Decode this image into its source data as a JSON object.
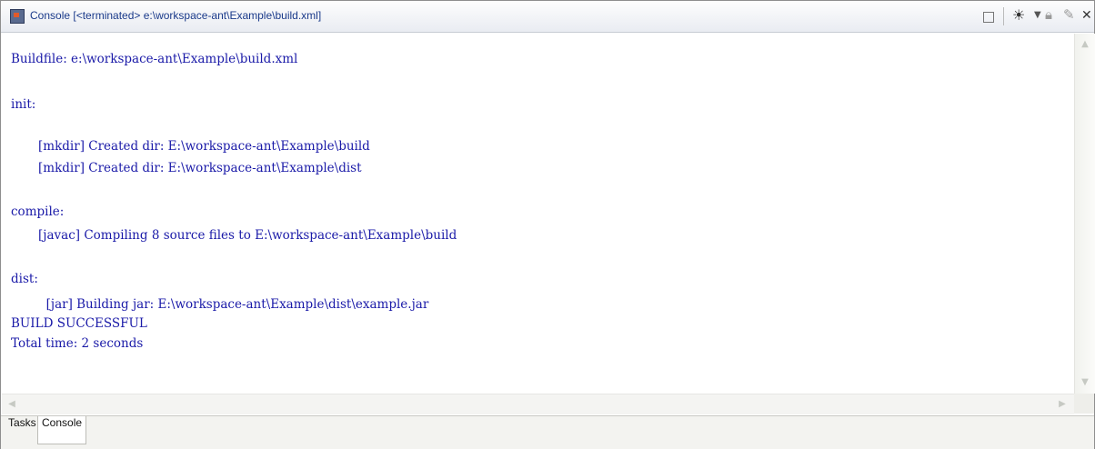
{
  "window": {
    "title": "Console [<terminated> e:\\workspace-ant\\Example\\build.xml]"
  },
  "console": {
    "lines": [
      "Buildfile: e:\\workspace-ant\\Example\\build.xml",
      "",
      "init:",
      "       [mkdir] Created dir: E:\\workspace-ant\\Example\\build",
      "       [mkdir] Created dir: E:\\workspace-ant\\Example\\dist",
      "",
      "compile:",
      "       [javac] Compiling 8 source files to E:\\workspace-ant\\Example\\build",
      "",
      "dist:",
      "         [jar] Building jar: E:\\workspace-ant\\Example\\dist\\example.jar",
      "BUILD SUCCESSFUL",
      "Total time: 2 seconds"
    ],
    "text_color": "#1a1aa8"
  },
  "toolbar": {
    "icons": [
      "maximize-icon",
      "run-icon",
      "dropdown-icon",
      "lock-icon",
      "clear-icon",
      "close-icon"
    ]
  },
  "tabs": [
    {
      "label": "Tasks",
      "active": false
    },
    {
      "label": "Console",
      "active": true
    }
  ]
}
